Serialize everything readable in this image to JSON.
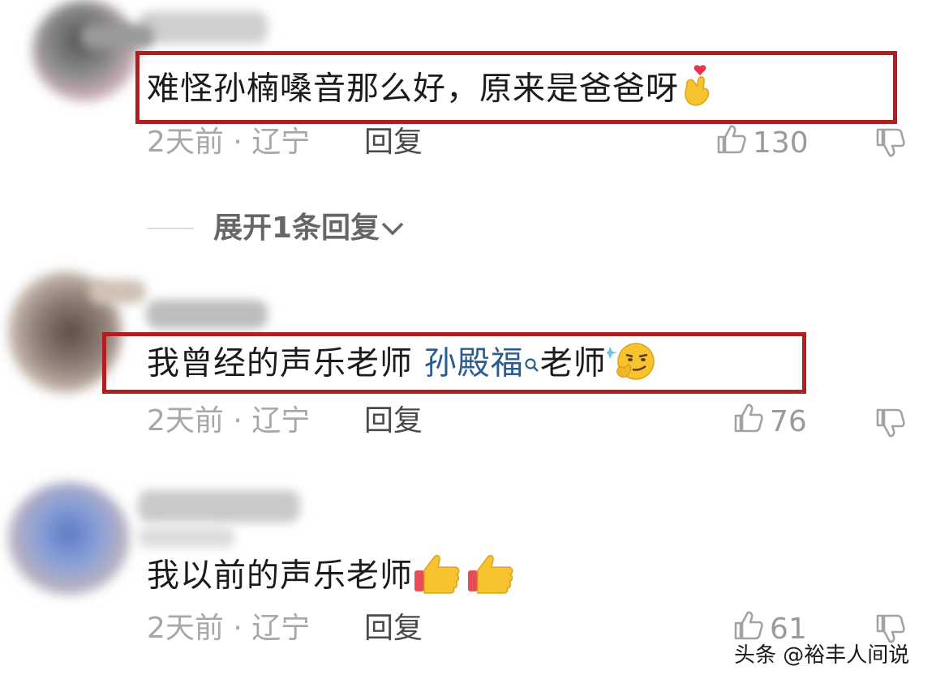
{
  "comments": [
    {
      "text": "难怪孙楠嗓音那么好，原来是爸爸呀",
      "emoji": "finger-heart-emoji",
      "meta": "2天前 · 辽宁",
      "reply_label": "回复",
      "likes": "130"
    },
    {
      "text_before": "我曾经的声乐老师 ",
      "link_text": "孙殿福",
      "text_after": "老师",
      "emoji": "smirk-thinking-emoji",
      "meta": "2天前 · 辽宁",
      "reply_label": "回复",
      "likes": "76"
    },
    {
      "text": "我以前的声乐老师",
      "emoji": "thumbs-up-emoji",
      "meta": "2天前 · 辽宁",
      "reply_label": "回复",
      "likes": "61"
    }
  ],
  "expand_replies": "展开1条回复",
  "watermark": "头条 @裕丰人间说",
  "colors": {
    "highlight_border": "#b01e1e",
    "link": "#2c5c8f",
    "meta": "#a7a7a7"
  }
}
